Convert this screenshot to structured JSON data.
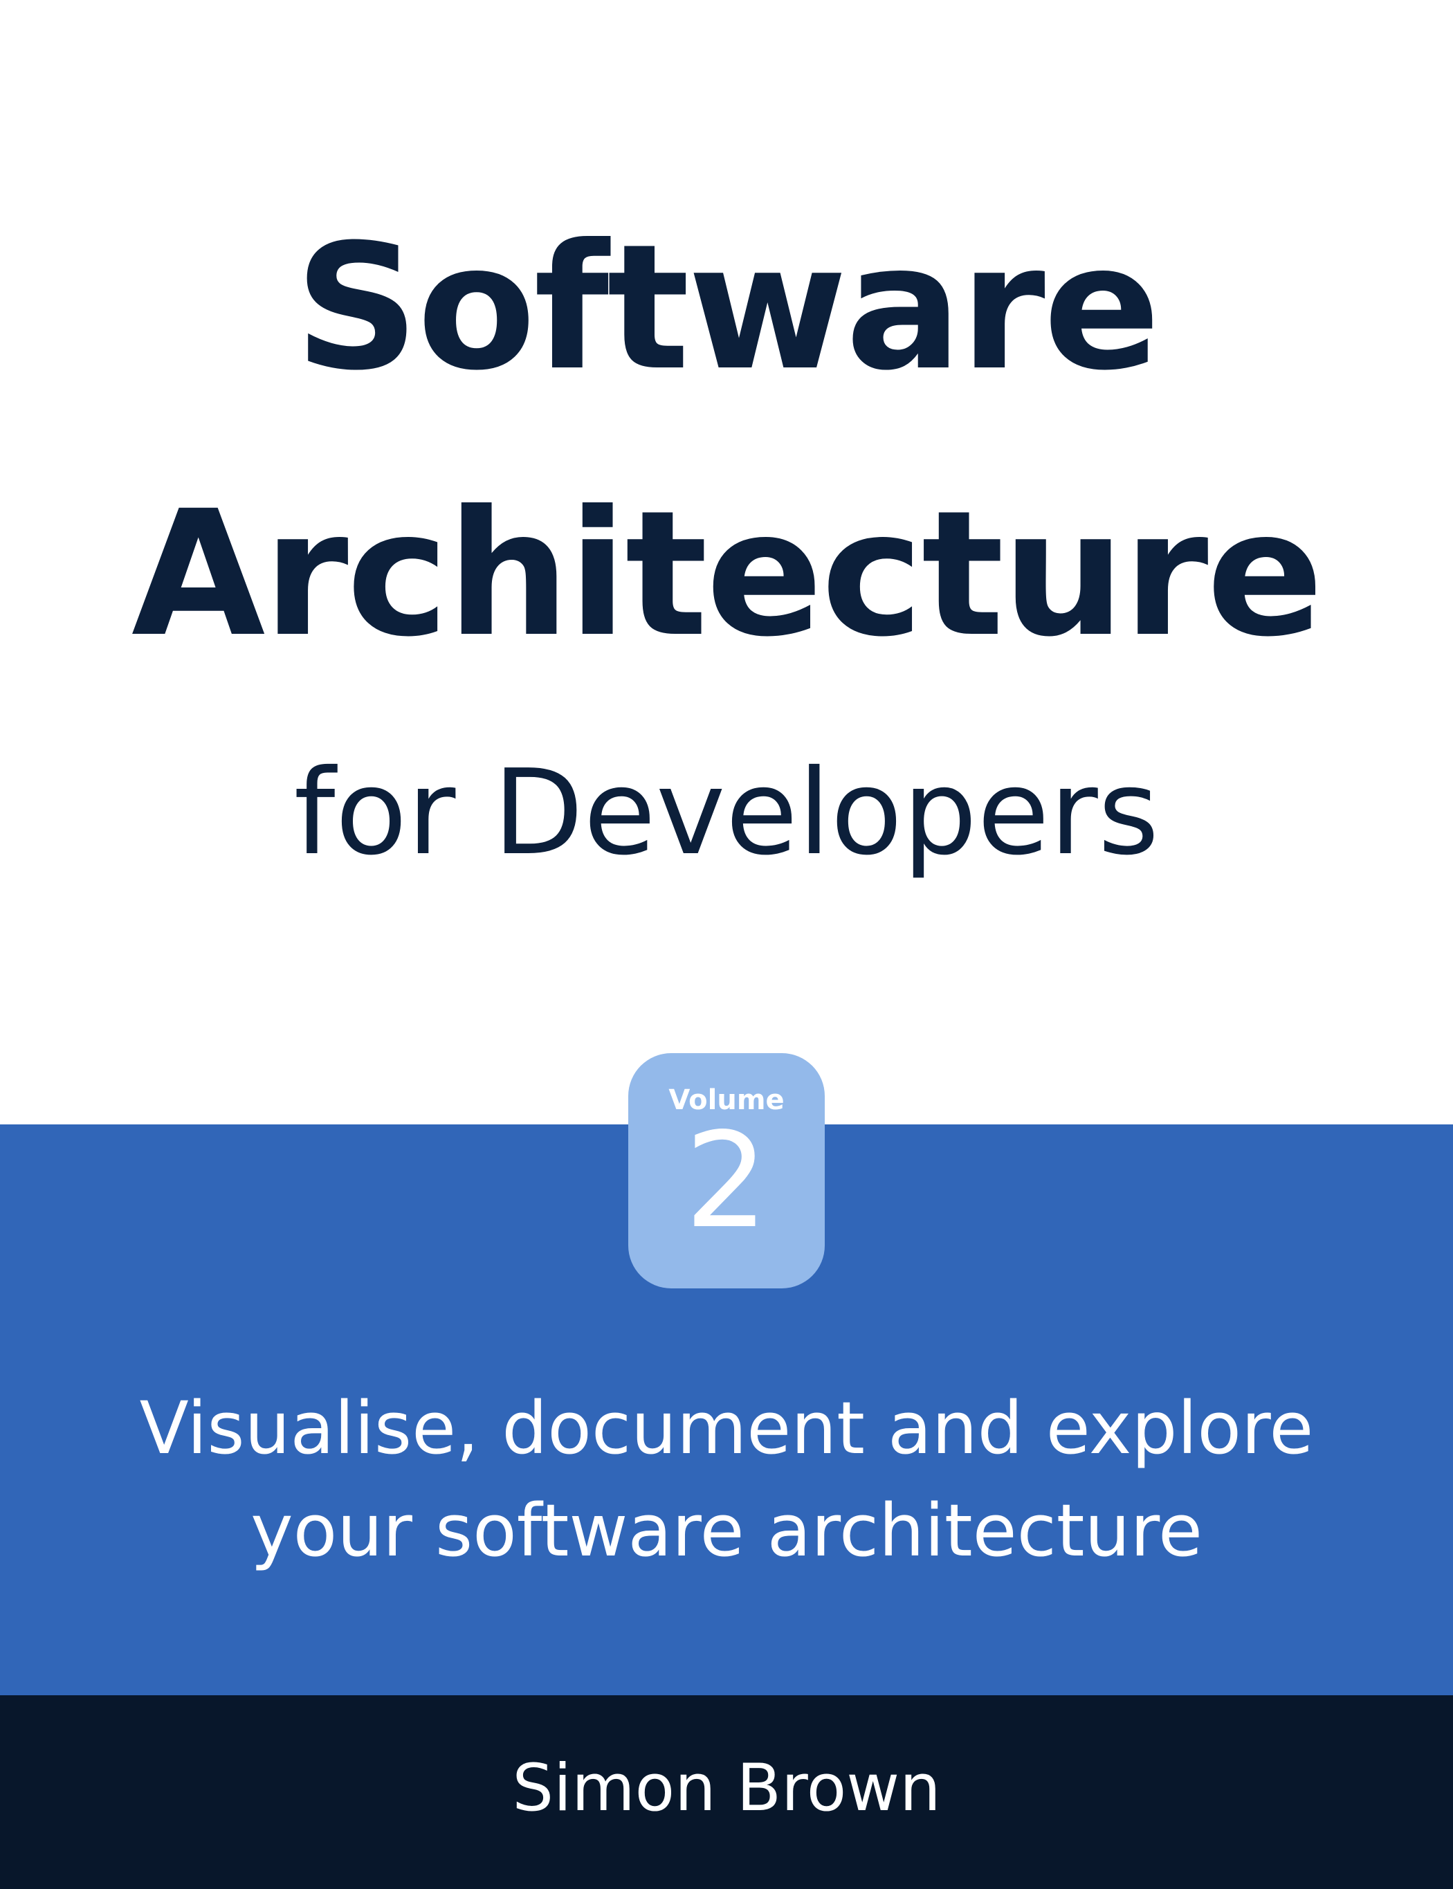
{
  "cover": {
    "title_line1": "Software",
    "title_line2": "Architecture",
    "subtitle": "for Developers",
    "volume_label": "Volume",
    "volume_number": "2",
    "tagline_line1": "Visualise, document and explore",
    "tagline_line2": "your software architecture",
    "author": "Simon Brown"
  },
  "colors": {
    "title_text": "#0c1f3a",
    "band_blue": "#3166b8",
    "badge_blue": "#93b9ea",
    "author_bar": "#08172b",
    "background": "#ffffff"
  }
}
